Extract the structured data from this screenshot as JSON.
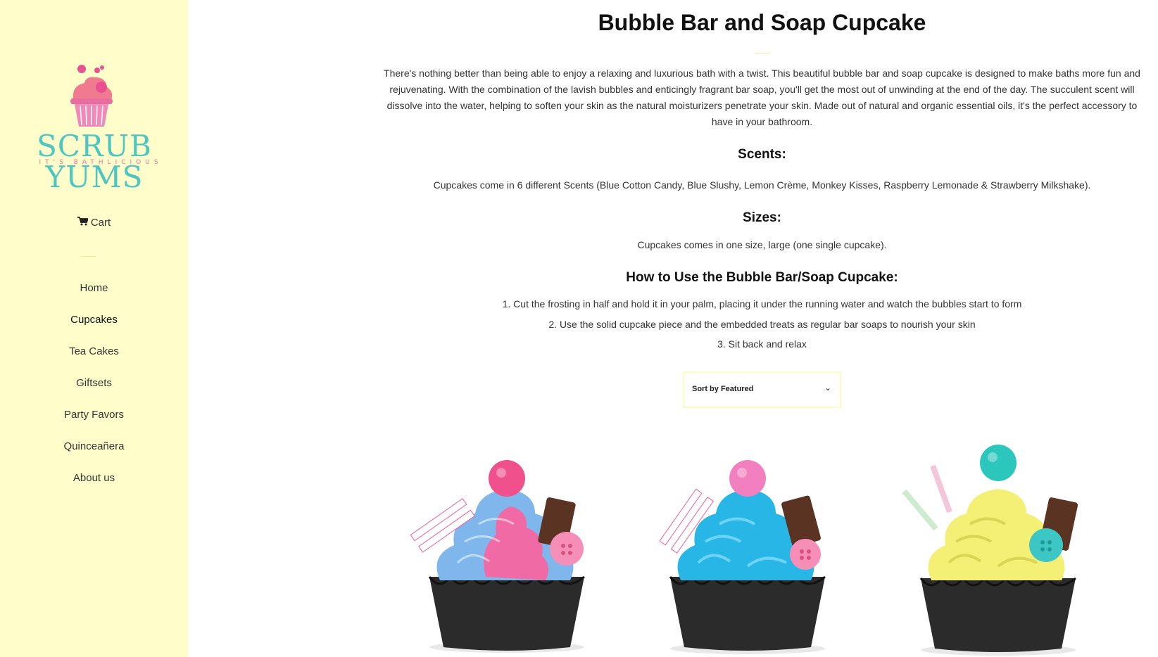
{
  "brand": {
    "name": "SCRUB YUMS",
    "tagline": "IT'S BATHLICIOUS"
  },
  "sidebar": {
    "cart_label": "Cart",
    "nav": [
      {
        "label": "Home"
      },
      {
        "label": "Cupcakes"
      },
      {
        "label": "Tea Cakes"
      },
      {
        "label": "Giftsets"
      },
      {
        "label": "Party Favors"
      },
      {
        "label": "Quinceañera"
      },
      {
        "label": "About us"
      }
    ],
    "active_item": "Cupcakes"
  },
  "main": {
    "title": "Bubble Bar and Soap Cupcake",
    "intro": "There's nothing better than being able to enjoy a relaxing and luxurious bath with a twist. This beautiful bubble bar and soap cupcake is designed to make baths more fun and rejuvenating. With the combination of the lavish bubbles and enticingly fragrant bar soap, you'll get the most out of unwinding at the end of the day. The succulent scent will dissolve into the water, helping to soften your skin as the natural moisturizers penetrate your skin. Made out of natural and organic essential oils, it's the perfect accessory to have in your bathroom.",
    "scents_heading": "Scents:",
    "scents_text": "Cupcakes come in 6 different Scents (Blue Cotton Candy, Blue Slushy, Lemon Crème, Monkey Kisses, Raspberry Lemonade & Strawberry Milkshake).",
    "sizes_heading": "Sizes:",
    "sizes_text": "Cupcakes comes in one size, large (one single cupcake).",
    "howto_heading": "How to Use the Bubble Bar/Soap Cupcake:",
    "howto_steps": [
      "1. Cut the frosting in half and hold it in your palm, placing it under the running water and watch the bubbles start to form",
      "2. Use the solid cupcake piece and the embedded treats as regular bar soaps to nourish your skin",
      "3. Sit back and relax"
    ],
    "sort": {
      "label": "Sort by Featured"
    },
    "products": [
      {
        "frosting_primary": "#7fb6ec",
        "frosting_secondary": "#f06aa6",
        "topper": "#f0508c",
        "button": "#f58fb8"
      },
      {
        "frosting_primary": "#27b6e6",
        "frosting_secondary": "#3cc4ef",
        "topper": "#f27fc0",
        "button": "#f58fb8"
      },
      {
        "frosting_primary": "#f3f075",
        "frosting_secondary": "#e7e45a",
        "topper": "#2bc7bd",
        "button": "#3cc7c4"
      }
    ]
  },
  "colors": {
    "sidebar_bg": "#fffecb",
    "brand_teal": "#4cc6c3",
    "brand_pink": "#f06fa1",
    "divider": "#f2ec9d"
  }
}
